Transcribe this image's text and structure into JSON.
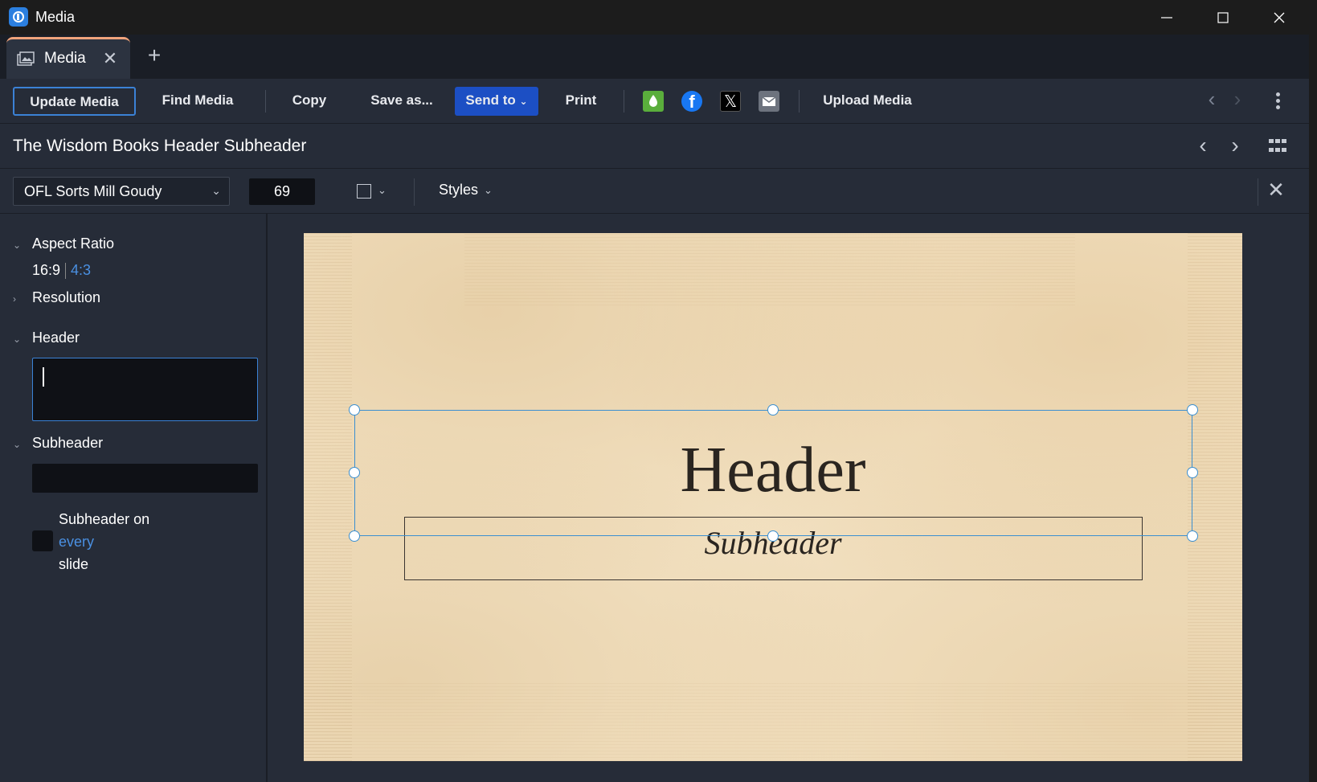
{
  "window": {
    "title": "Media"
  },
  "tabs": [
    {
      "label": "Media"
    }
  ],
  "toolbar": {
    "update_media": "Update Media",
    "find_media": "Find Media",
    "copy": "Copy",
    "save_as": "Save as...",
    "send_to": "Send to",
    "print": "Print",
    "upload_media": "Upload Media"
  },
  "document": {
    "title": "The Wisdom Books Header Subheader"
  },
  "fontbar": {
    "font_family": "OFL Sorts Mill Goudy",
    "font_size": "69",
    "styles": "Styles"
  },
  "sidebar": {
    "aspect_ratio": {
      "label": "Aspect Ratio",
      "option_a": "16:9",
      "option_b": "4:3"
    },
    "resolution": {
      "label": "Resolution"
    },
    "header": {
      "label": "Header",
      "value": ""
    },
    "subheader": {
      "label": "Subheader",
      "value": ""
    },
    "subheader_every": {
      "line1": "Subheader on",
      "line2": "every",
      "line3": "slide"
    }
  },
  "slide": {
    "header": "Header",
    "subheader": "Subheader"
  },
  "colors": {
    "accent": "#3b82d6",
    "send_button": "#1c4fc4",
    "tab_accent": "#f0a37b",
    "slide_bg": "#f3e2c3"
  }
}
